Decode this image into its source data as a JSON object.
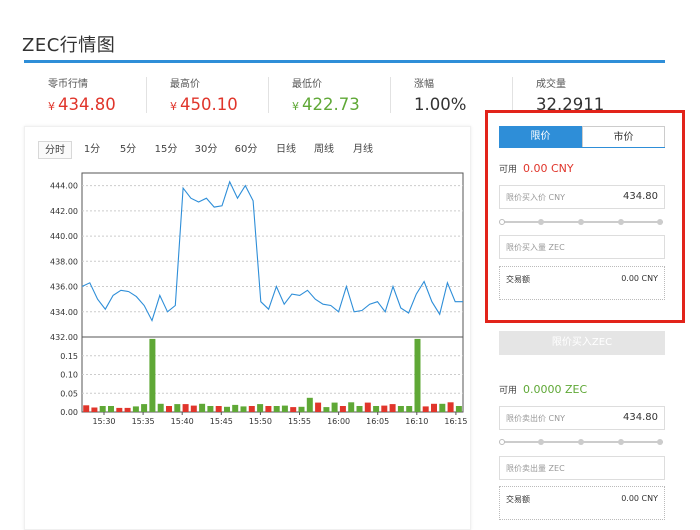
{
  "page": {
    "title": "ZEC行情图"
  },
  "stats": [
    {
      "label": "零币行情",
      "currency": "¥",
      "value": "434.80",
      "color": "red"
    },
    {
      "label": "最高价",
      "currency": "¥",
      "value": "450.10",
      "color": "red"
    },
    {
      "label": "最低价",
      "currency": "¥",
      "value": "422.73",
      "color": "green"
    },
    {
      "label": "涨幅",
      "currency": "",
      "value": "1.00%",
      "color": "dark"
    },
    {
      "label": "成交量",
      "currency": "",
      "value": "32.2911",
      "color": "dark"
    }
  ],
  "tabs": [
    "分时",
    "1分",
    "5分",
    "15分",
    "30分",
    "60分",
    "日线",
    "周线",
    "月线"
  ],
  "active_tab": 0,
  "colors": {
    "accent": "#2e8ed8",
    "up": "#e0352b",
    "down": "#5fa836",
    "highlight_box": "#e2231a"
  },
  "chart_data": {
    "type": "line",
    "price": {
      "ylim": [
        432.0,
        445.0
      ],
      "yticks": [
        "444.00",
        "442.00",
        "440.00",
        "438.00",
        "436.00",
        "434.00",
        "432.00"
      ],
      "values": [
        436.0,
        436.3,
        435.0,
        434.2,
        435.3,
        435.7,
        435.6,
        435.2,
        434.5,
        433.3,
        435.3,
        434.0,
        434.5,
        443.8,
        443.0,
        442.7,
        443.0,
        442.3,
        442.4,
        444.3,
        443.0,
        444.0,
        442.8,
        434.8,
        434.2,
        436.0,
        434.6,
        435.4,
        435.3,
        435.7,
        435.0,
        434.6,
        434.5,
        434.0,
        436.0,
        434.0,
        434.1,
        434.6,
        434.8,
        434.0,
        436.0,
        434.3,
        433.9,
        435.4,
        436.4,
        434.8,
        433.8,
        436.3,
        434.8,
        434.8
      ]
    },
    "volume": {
      "ylim": [
        0,
        0.2
      ],
      "yticks": [
        "0.15",
        "0.10",
        "0.05",
        "0.00"
      ],
      "values": [
        0.018,
        0.012,
        0.016,
        0.016,
        0.011,
        0.011,
        0.015,
        0.021,
        0.195,
        0.022,
        0.016,
        0.021,
        0.021,
        0.017,
        0.022,
        0.016,
        0.016,
        0.014,
        0.019,
        0.015,
        0.016,
        0.021,
        0.016,
        0.016,
        0.017,
        0.013,
        0.014,
        0.038,
        0.025,
        0.013,
        0.025,
        0.016,
        0.026,
        0.016,
        0.025,
        0.016,
        0.017,
        0.021,
        0.016,
        0.016,
        0.195,
        0.015,
        0.022,
        0.022,
        0.026,
        0.016
      ],
      "up": [
        true,
        true,
        false,
        false,
        true,
        true,
        false,
        false,
        false,
        false,
        true,
        false,
        true,
        true,
        false,
        false,
        true,
        false,
        false,
        false,
        true,
        false,
        true,
        false,
        false,
        true,
        false,
        false,
        true,
        false,
        false,
        true,
        false,
        false,
        true,
        false,
        true,
        true,
        false,
        false,
        false,
        true,
        true,
        false,
        true,
        false
      ]
    },
    "x_ticks": [
      "15:30",
      "15:35",
      "15:40",
      "15:45",
      "15:50",
      "15:55",
      "16:00",
      "16:05",
      "16:10",
      "16:15"
    ],
    "grid": true
  },
  "buy": {
    "tab_limit": "限价",
    "tab_market": "市价",
    "avail_label": "可用",
    "avail_value": "0.00 CNY",
    "price_placeholder": "限价买入价 CNY",
    "price_value": "434.80",
    "amount_placeholder": "限价买入量 ZEC",
    "total_label": "交易额",
    "total_value": "0.00 CNY",
    "button": "限价买入ZEC"
  },
  "sell": {
    "avail_label": "可用",
    "avail_value": "0.0000 ZEC",
    "price_placeholder": "限价卖出价 CNY",
    "price_value": "434.80",
    "amount_placeholder": "限价卖出量 ZEC",
    "total_label": "交易额",
    "total_value": "0.00 CNY"
  }
}
